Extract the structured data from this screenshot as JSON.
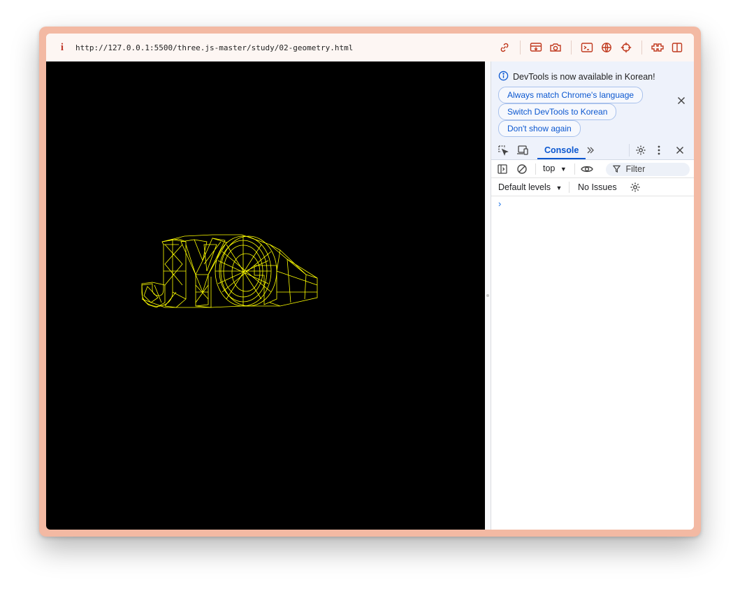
{
  "address_bar": {
    "info_symbol": "i",
    "url": "http://127.0.0.1:5500/three.js-master/study/02-geometry.html",
    "icons": [
      "link-icon",
      "screencast-icon",
      "camera-icon",
      "terminal-icon",
      "globe-icon",
      "crosshair-icon",
      "extensions-icon",
      "split-view-icon"
    ]
  },
  "scene": {
    "background": "#000000",
    "wireframe_color": "#ffff00",
    "text_object": "JYG"
  },
  "devtools": {
    "banner": {
      "title": "DevTools is now available in Korean!",
      "always_match": "Always match Chrome's language",
      "switch_korean": "Switch DevTools to Korean",
      "dont_show": "Don't show again"
    },
    "tabs": {
      "console": "Console"
    },
    "console_toolbar": {
      "context": "top",
      "filter_placeholder": "Filter"
    },
    "levels": {
      "default_levels": "Default levels",
      "issues": "No Issues"
    },
    "prompt_symbol": "›",
    "accent_color": "#0b57d0"
  }
}
